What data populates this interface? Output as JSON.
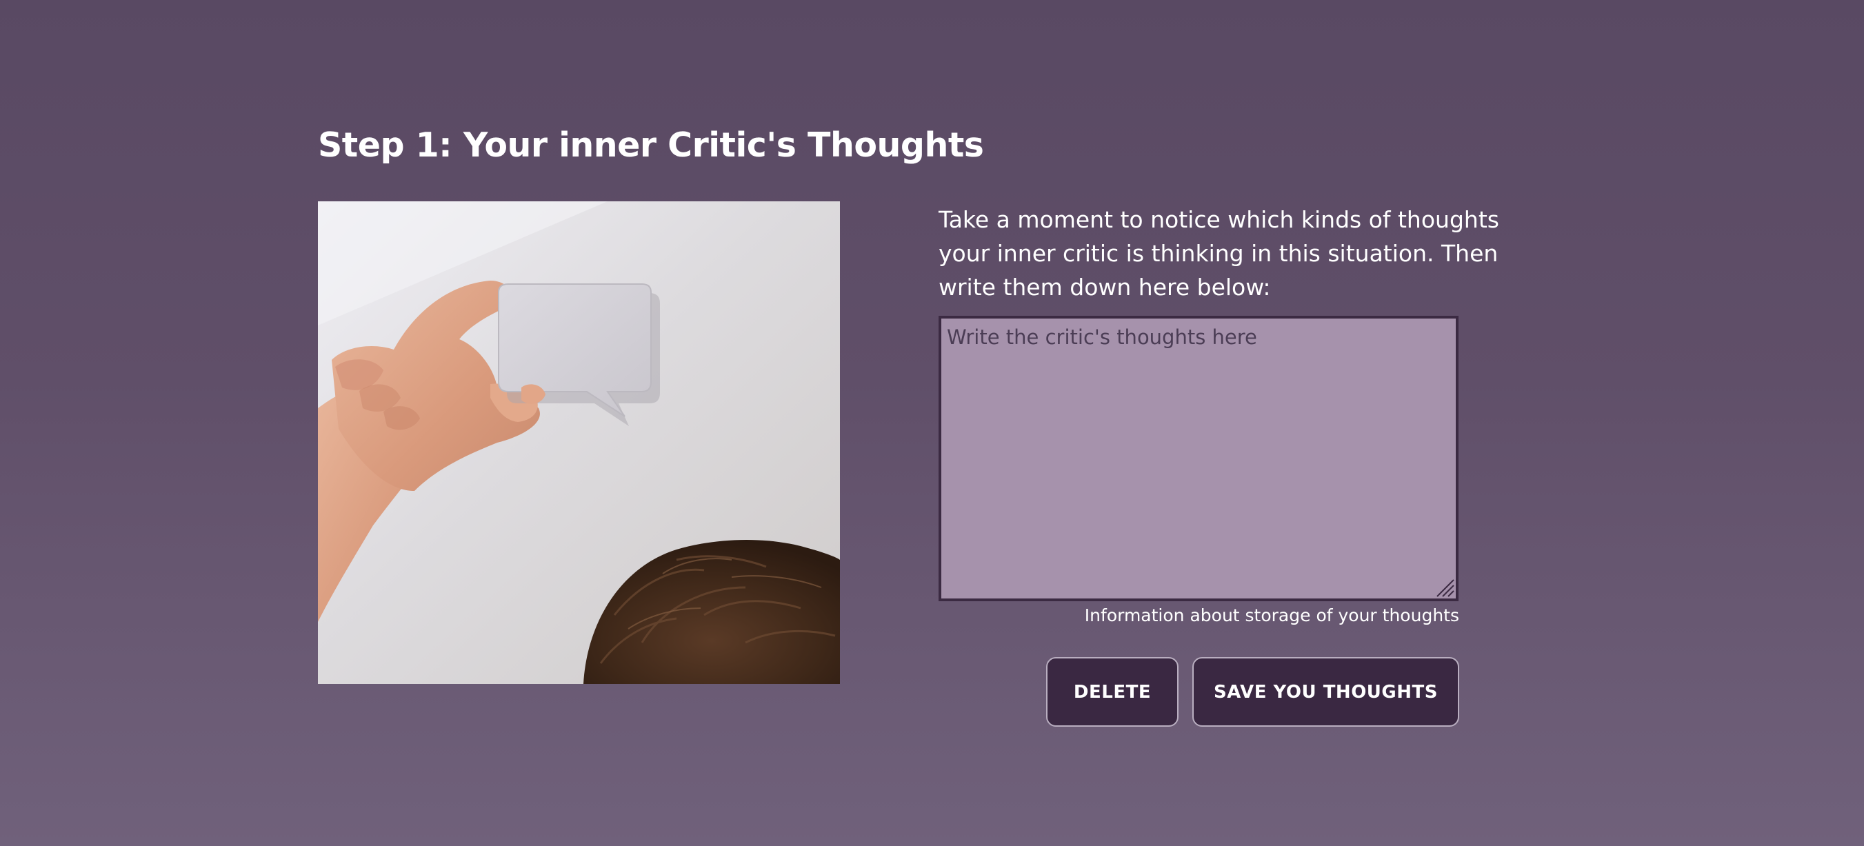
{
  "step": {
    "title": "Step 1: Your inner Critic's Thoughts"
  },
  "intro": {
    "text": "Take a moment to notice which kinds of thoughts your inner critic is thinking in this situation. Then write them down here below:"
  },
  "thoughts_input": {
    "placeholder": "Write the critic's thoughts here",
    "value": ""
  },
  "storage_info": {
    "label": "Information about storage of your thoughts"
  },
  "buttons": {
    "delete_label": "DELETE",
    "save_label": "SAVE YOU THOUGHTS"
  },
  "colors": {
    "background_top": "#594963",
    "background_bottom": "#70617b",
    "textarea_fill": "#a692ac",
    "textarea_border": "#3b2a42",
    "button_fill": "#3a2842",
    "button_border": "#b9aec0",
    "text": "#ffffff"
  },
  "image": {
    "subject": "hand holding a white speech bubble above a person's head"
  }
}
